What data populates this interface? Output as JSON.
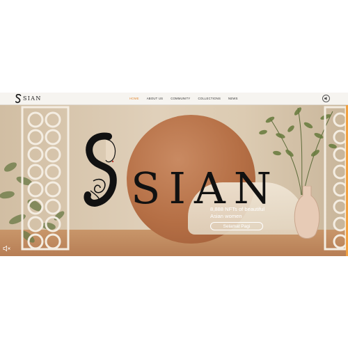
{
  "brand": {
    "name": "SIAN",
    "logo_mark": "S"
  },
  "nav": {
    "items": [
      {
        "label": "HOME",
        "active": true
      },
      {
        "label": "ABOUT US",
        "active": false
      },
      {
        "label": "COMMUNITY",
        "active": false
      },
      {
        "label": "COLLECTIONS",
        "active": false
      },
      {
        "label": "NEWS",
        "active": false
      }
    ],
    "sound_icon": "speaker-circle-icon"
  },
  "hero": {
    "title": "SIAN",
    "title_mark": "S",
    "tagline": "8,888 NFTs of beautiful Asian women",
    "button_label": "Selamat Pagi",
    "mute_icon": "speaker-muted-icon"
  },
  "colors": {
    "accent": "#e28a35",
    "nav_background": "#f6f4f0",
    "disc": "#b56f45",
    "hero_text": "#ffffff"
  }
}
